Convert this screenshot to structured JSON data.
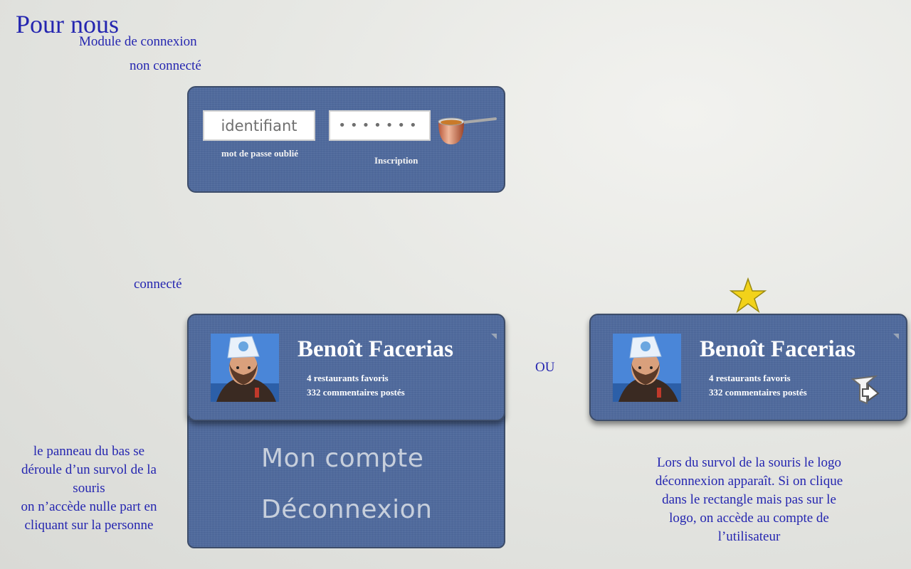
{
  "header": {
    "title": "Pour nous",
    "subtitle": "Module de connexion",
    "state_not_connected": "non connecté",
    "state_connected": "connecté"
  },
  "login_module": {
    "username_placeholder": "identifiant",
    "password_masked": "•••••••",
    "forgot_password": "mot de passe oublié",
    "signup": "Inscription",
    "submit_icon": "saucepan-icon"
  },
  "user_card": {
    "name": "Benoît Facerias",
    "favorites": "4 restaurants favoris",
    "comments": "332 commentaires postés"
  },
  "dropdown_menu": {
    "items": [
      "Mon compte",
      "Déconnexion"
    ]
  },
  "separator_text": "OU",
  "notes": {
    "left": [
      "le panneau du bas se",
      "déroule d’un survol de la",
      "souris",
      "on n’accède nulle part en",
      "cliquant sur la personne"
    ],
    "right": [
      "Lors du survol de la souris le logo",
      "déconnexion apparaît. Si on clique",
      "dans le rectangle mais pas sur le",
      "logo, on accède au compte de",
      "l’utilisateur"
    ]
  },
  "colors": {
    "panel": "#4f6a9e",
    "annotation_text": "#2526b0",
    "star": "#f2d21a"
  }
}
